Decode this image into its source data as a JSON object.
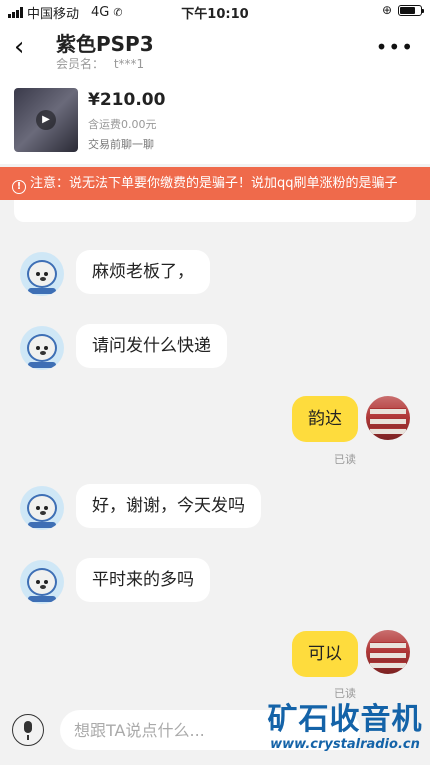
{
  "status_bar": {
    "carrier": "中国移动",
    "network": "4G",
    "time": "下午10:10"
  },
  "header": {
    "title": "紫色PSP3",
    "member_label": "会员名：",
    "member_name": "t***1",
    "back_icon": "chevron-left-icon",
    "more_icon": "more-dots-icon"
  },
  "product": {
    "price": "¥210.00",
    "shipping": "含运费0.00元",
    "pre_chat": "交易前聊一聊"
  },
  "warning": {
    "text": "注意：说无法下单要你缴费的是骗子！说加qq刷单涨粉的是骗子",
    "color": "#ef6a4b"
  },
  "messages": [
    {
      "from": "other",
      "text": "麻烦老板了，"
    },
    {
      "from": "other",
      "text": "请问发什么快递"
    },
    {
      "from": "me",
      "text": "韵达",
      "status": "已读"
    },
    {
      "from": "other",
      "text": "好，谢谢，今天发吗"
    },
    {
      "from": "other",
      "text": "平时来的多吗"
    },
    {
      "from": "me",
      "text": "可以",
      "status": "已读"
    }
  ],
  "input": {
    "placeholder": "想跟TA说点什么...",
    "mic_icon": "microphone-icon"
  },
  "watermark": {
    "cn": "矿石收音机",
    "url": "www.crystalradio.cn"
  },
  "colors": {
    "my_bubble": "#fedc3d",
    "other_bubble": "#ffffff",
    "background": "#f2f2f2"
  }
}
